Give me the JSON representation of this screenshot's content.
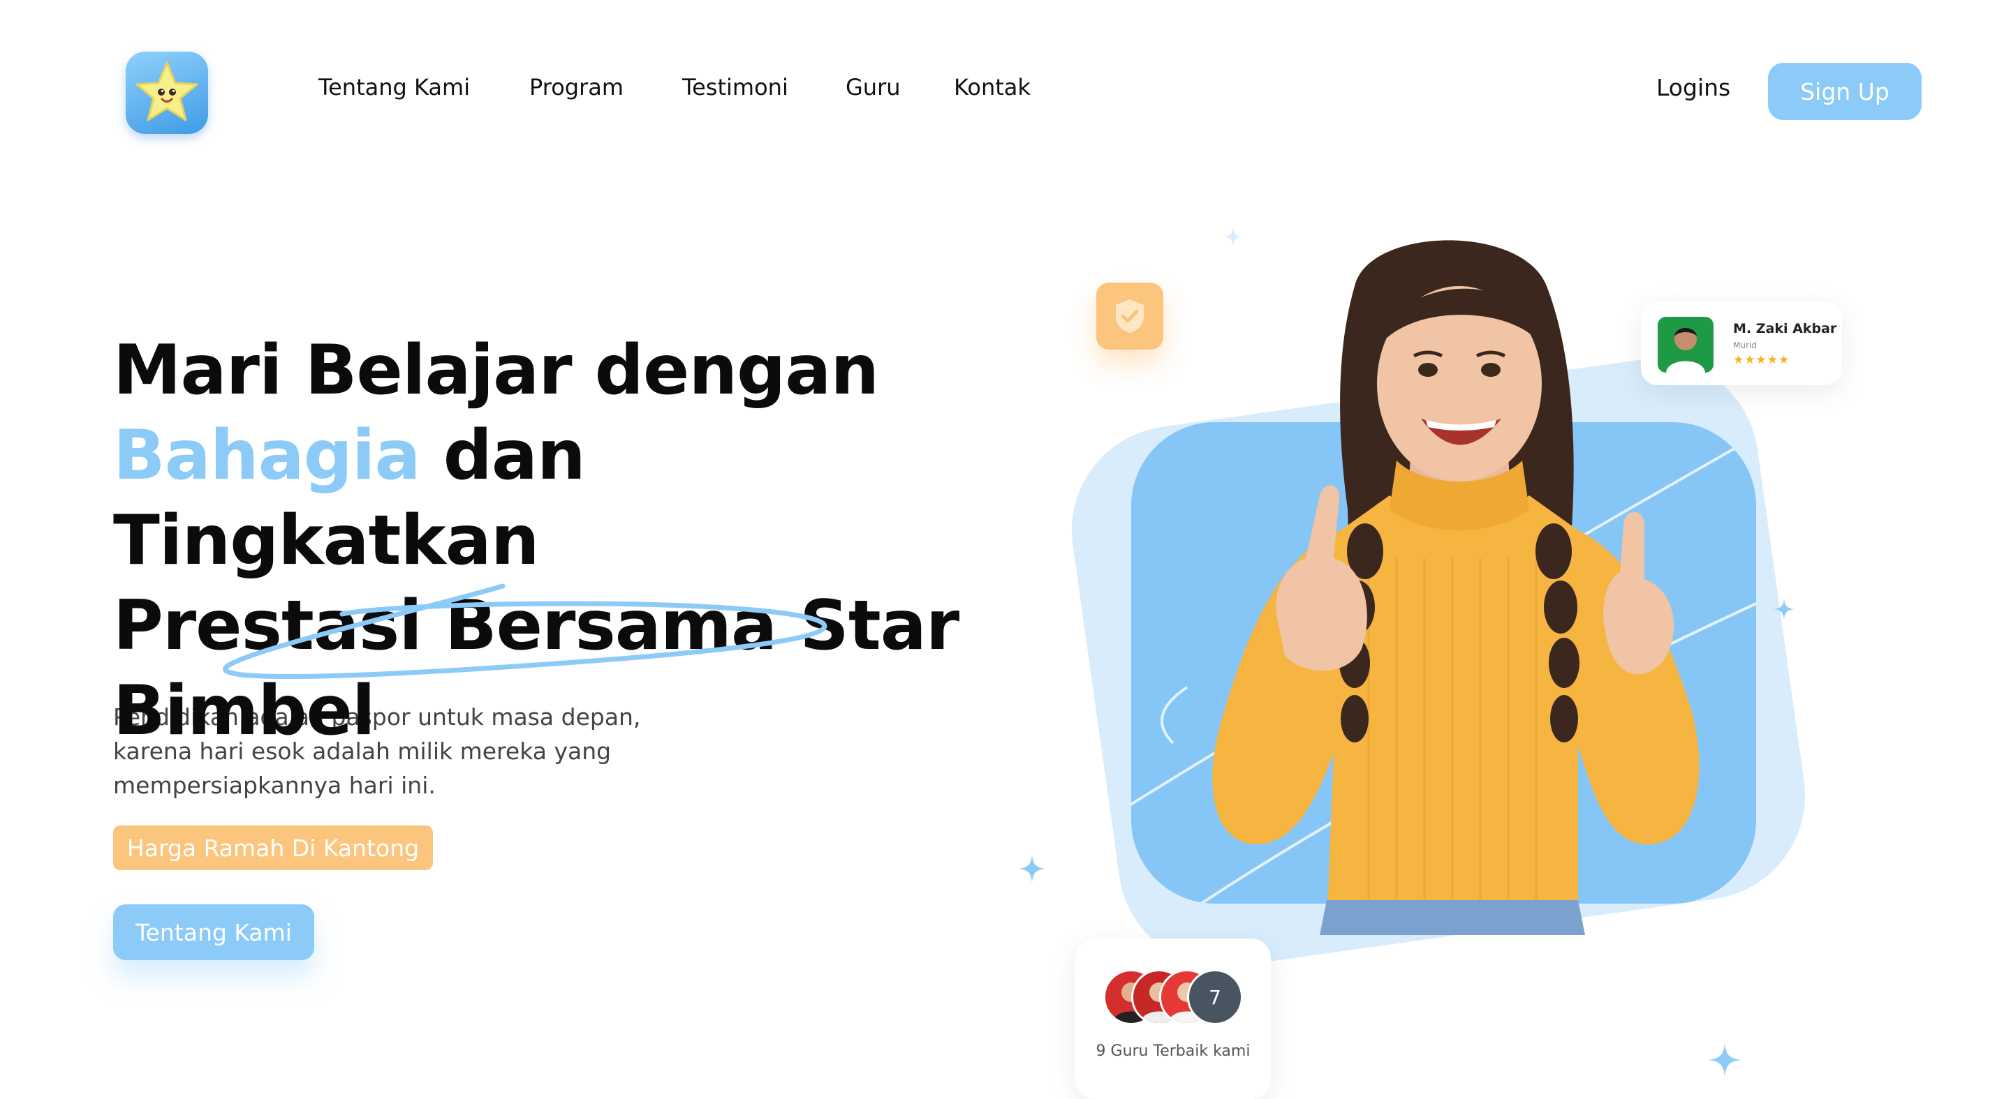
{
  "nav": {
    "links": [
      "Tentang Kami",
      "Program",
      "Testimoni",
      "Guru",
      "Kontak"
    ],
    "login": "Logins",
    "signup": "Sign Up"
  },
  "hero": {
    "headline_part1": "Mari Belajar dengan",
    "headline_accent": "Bahagia",
    "headline_part2": "dan Tingkatkan",
    "headline_part3": "Prestasi Bersama Star",
    "headline_part4": "Bimbel",
    "description": "Pendidikan adalah paspor untuk masa depan, karena hari esok adalah milik mereka yang mempersiapkannya hari ini.",
    "price_badge": "Harga Ramah Di Kantong",
    "cta": "Tentang Kami"
  },
  "review_card": {
    "name": "M. Zaki Akbar",
    "role": "Murid",
    "rating": 5
  },
  "teacher_card": {
    "count_badge": "7",
    "label": "9 Guru Terbaik kami"
  },
  "colors": {
    "accent_blue": "#8ccaf8",
    "accent_orange": "#fcc57e",
    "text_dark": "#0b0b0b"
  }
}
